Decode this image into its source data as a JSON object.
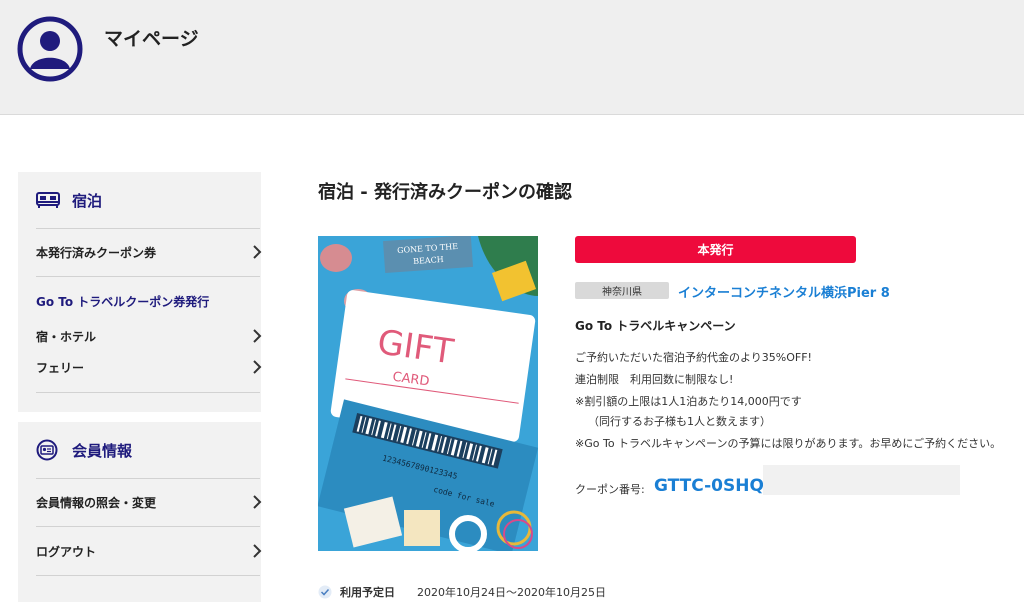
{
  "header": {
    "title": "マイページ",
    "icon": "user-avatar-icon",
    "accent": "#1f1b7d"
  },
  "sidebar": {
    "lodging": {
      "title": "宿泊",
      "icon": "bed-icon",
      "issued_coupon": "本発行済みクーポン券",
      "goto_heading": "Go To トラベルクーポン券発行",
      "items": [
        "宿・ホテル",
        "フェリー"
      ]
    },
    "member": {
      "title": "会員情報",
      "icon": "member-card-icon",
      "items": [
        "会員情報の照会・変更",
        "ログアウト"
      ]
    }
  },
  "main": {
    "title": "宿泊 - 発行済みクーポンの確認",
    "image": {
      "sign_text": "GONE TO THE BEACH",
      "card_text": "GIFT",
      "card_sub": "CARD",
      "barcode_number": "1234567890123345",
      "script_text": "code for sale"
    },
    "status_badge": "本発行",
    "status_color": "#ee0a3c",
    "prefecture": "神奈川県",
    "hotel_name": "インターコンチネンタル横浜Pier 8",
    "campaign": "Go To トラベルキャンペーン",
    "description": [
      "ご予約いただいた宿泊予約代金のより35%OFF!",
      "連泊制限　利用回数に制限なし!",
      "※割引額の上限は1人1泊あたり14,000円です",
      "（同行するお子様も1人と数えます）",
      "※Go To トラベルキャンペーンの予算には限りがあります。お早めにご予約ください。"
    ],
    "coupon_label": "クーポン番号:",
    "coupon_code": "GTTC-0SHQ-",
    "period_label": "利用予定日",
    "period_value": "2020年10月24日〜2020年10月25日"
  }
}
